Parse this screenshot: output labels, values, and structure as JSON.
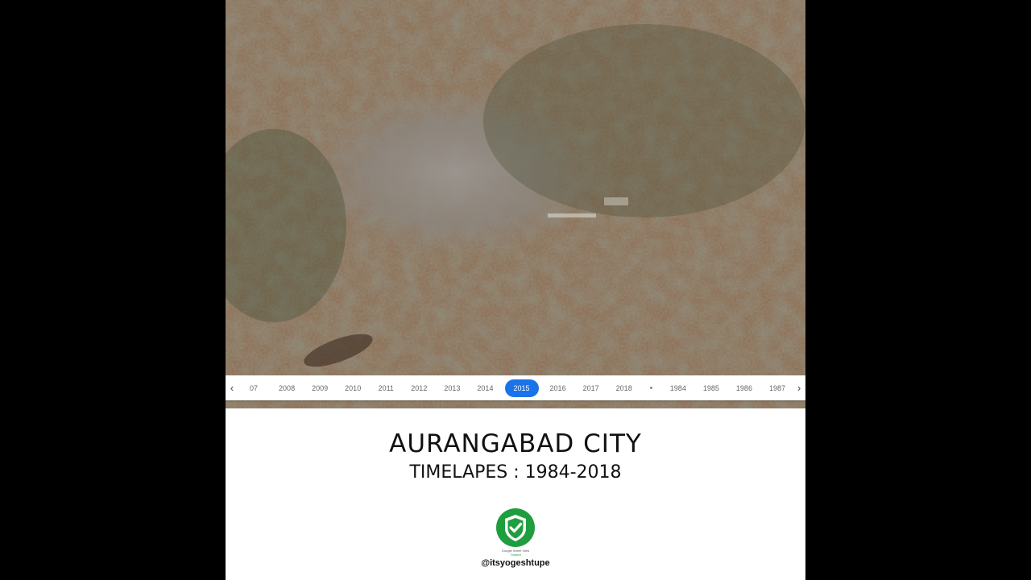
{
  "timeline": {
    "years": [
      "07",
      "2008",
      "2009",
      "2010",
      "2011",
      "2012",
      "2013",
      "2014",
      "2015",
      "2016",
      "2017",
      "2018",
      "•",
      "1984",
      "1985",
      "1986",
      "1987"
    ],
    "active_year": "2015",
    "prev_icon": "chevron-left-icon",
    "next_icon": "chevron-right-icon"
  },
  "heading": {
    "title": "AURANGABAD CITY",
    "subtitle": "TIMELAPES : 1984-2018"
  },
  "badge": {
    "icon": "street-view-trusted-shield-icon",
    "caption_line1": "Google Street View",
    "caption_line2": "Trusted",
    "color": "#1e9e3e"
  },
  "credit": {
    "handle": "@itsyogeshtupe"
  },
  "colors": {
    "active_year_bg": "#1a73e8"
  }
}
